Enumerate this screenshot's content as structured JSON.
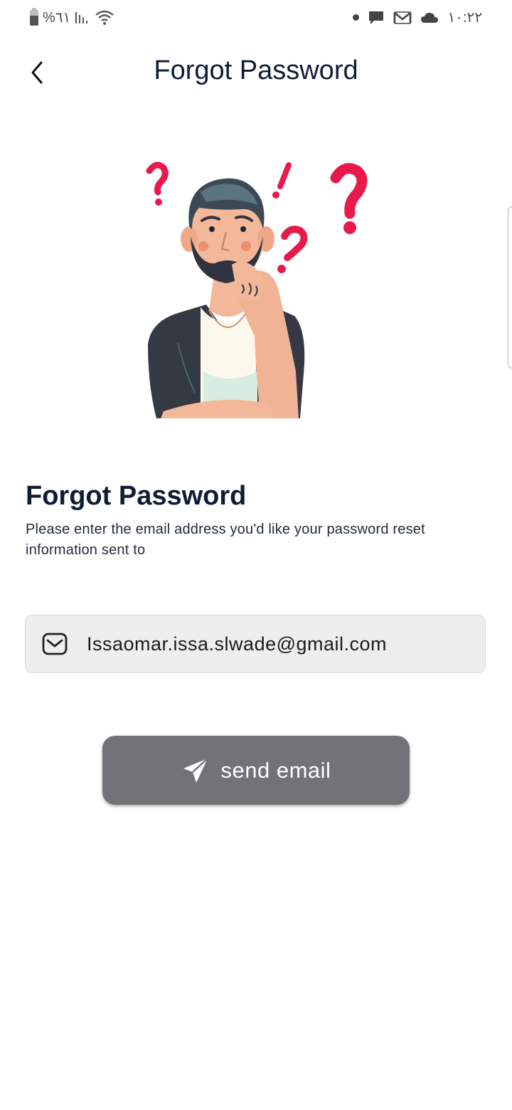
{
  "status_bar": {
    "battery_text": "%٦١",
    "time": "١٠:٢٢",
    "icons": [
      "battery-icon",
      "signal-icon",
      "wifi-icon",
      "dot-icon",
      "chat-icon",
      "gmail-icon",
      "cloud-icon"
    ]
  },
  "header": {
    "title": "Forgot Password",
    "back_icon": "chevron-left-icon"
  },
  "illustration": {
    "subject": "confused-man-illustration",
    "accent_color": "#e8194b"
  },
  "content": {
    "title": "Forgot Password",
    "description": "Please enter the email address you'd like your password reset information sent to"
  },
  "email_field": {
    "icon": "envelope-icon",
    "value": "Issaomar.issa.slwade@gmail.com"
  },
  "send_button": {
    "icon": "paper-plane-icon",
    "label": "send email",
    "color": "#737276"
  }
}
